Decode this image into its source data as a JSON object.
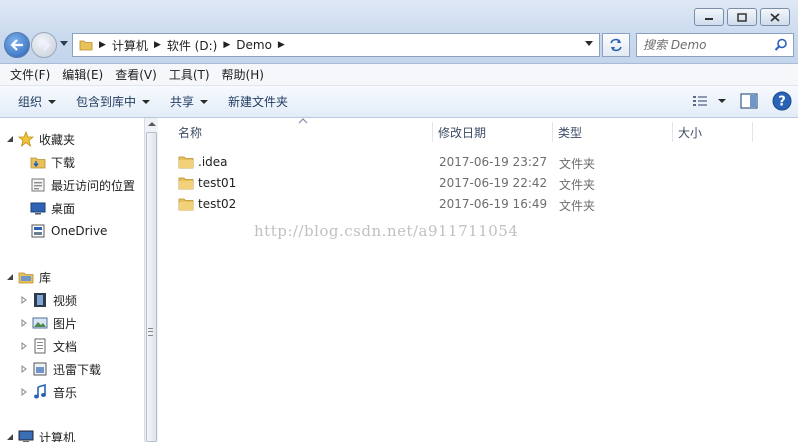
{
  "window": {
    "breadcrumbs": [
      "计算机",
      "软件 (D:)",
      "Demo"
    ],
    "search_placeholder": "搜索 Demo"
  },
  "menu": [
    "文件(F)",
    "编辑(E)",
    "查看(V)",
    "工具(T)",
    "帮助(H)"
  ],
  "toolbar": {
    "organize": "组织",
    "include_in_library": "包含到库中",
    "share": "共享",
    "new_folder": "新建文件夹"
  },
  "sidebar": {
    "favorites": "收藏夹",
    "favorites_items": [
      "下载",
      "最近访问的位置",
      "桌面",
      "OneDrive"
    ],
    "libraries": "库",
    "libraries_items": [
      "视频",
      "图片",
      "文档",
      "迅雷下载",
      "音乐"
    ],
    "computer": "计算机"
  },
  "columns": [
    "名称",
    "修改日期",
    "类型",
    "大小"
  ],
  "files": [
    {
      "name": ".idea",
      "date": "2017-06-19 23:27",
      "type": "文件夹"
    },
    {
      "name": "test01",
      "date": "2017-06-19 22:42",
      "type": "文件夹"
    },
    {
      "name": "test02",
      "date": "2017-06-19 16:49",
      "type": "文件夹"
    }
  ],
  "watermark": "http://blog.csdn.net/a911711054",
  "colors": {
    "accent": "#2a63b5",
    "folder": "#e8c15a",
    "toolbar_text": "#1e3a5f"
  }
}
